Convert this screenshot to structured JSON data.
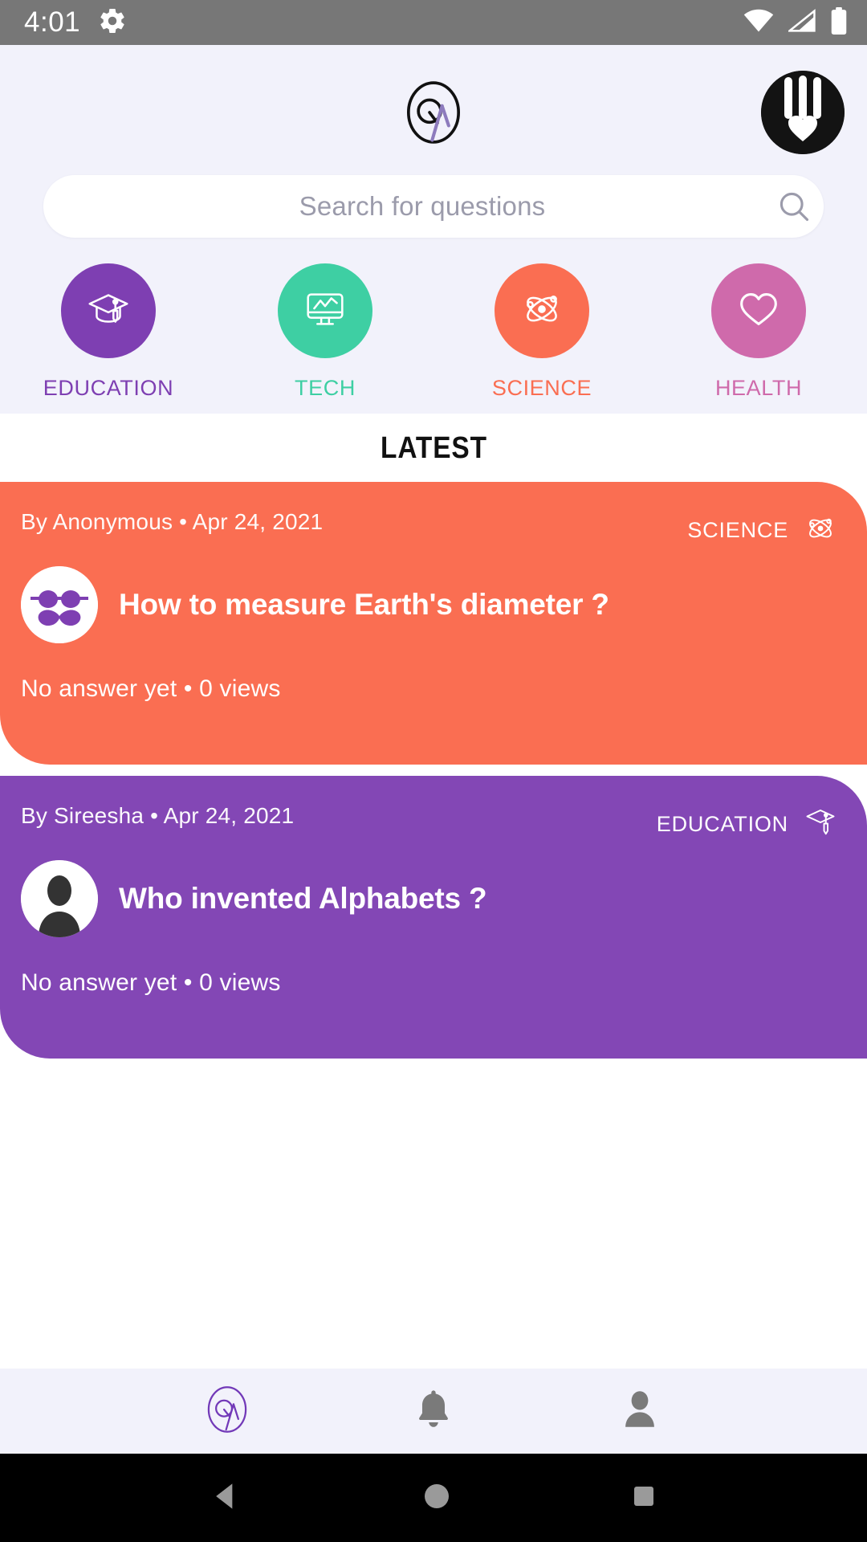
{
  "statusbar": {
    "time": "4:01",
    "icons": [
      "gear-icon",
      "wifi-icon",
      "cellular-signal-icon",
      "battery-icon"
    ]
  },
  "header": {
    "logo_name": "qa-logo",
    "logo_letters": "QA",
    "brand_avatar_name": "brand-avatar-icon"
  },
  "search": {
    "placeholder": "Search for questions",
    "value": "",
    "icon": "search-icon"
  },
  "categories": [
    {
      "label": "EDUCATION",
      "color": "#7E3FB2",
      "icon": "graduation-cap-icon"
    },
    {
      "label": "TECH",
      "color": "#3ECFA3",
      "icon": "monitor-chart-icon"
    },
    {
      "label": "SCIENCE",
      "color": "#FA6E52",
      "icon": "atom-icon"
    },
    {
      "label": "HEALTH",
      "color": "#CF6AAB",
      "icon": "heart-icon"
    }
  ],
  "section": {
    "latest_title": "LATEST"
  },
  "feed": [
    {
      "byline": "By Anonymous • Apr 24, 2021",
      "category": "SCIENCE",
      "category_icon": "atom-icon",
      "title": "How to measure Earth's diameter ?",
      "meta": "No answer yet • 0 views",
      "color": "#FA6E52",
      "avatar": "anonymous-mustache-avatar"
    },
    {
      "byline": "By Sireesha • Apr 24, 2021",
      "category": "EDUCATION",
      "category_icon": "graduation-cap-icon",
      "title": "Who invented Alphabets ?",
      "meta": "No answer yet • 0 views",
      "color": "#8347B5",
      "avatar": "default-person-avatar"
    }
  ],
  "bottomnav": [
    {
      "name": "home-qa-icon",
      "active": true
    },
    {
      "name": "notifications-bell-icon",
      "active": false
    },
    {
      "name": "profile-person-icon",
      "active": false
    }
  ],
  "androidnav": [
    {
      "name": "back-button"
    },
    {
      "name": "home-button"
    },
    {
      "name": "recents-button"
    }
  ],
  "colors": {
    "page_tint": "#F2F2FB",
    "statusbar": "#777777",
    "accent_purple": "#7E3FB2",
    "accent_orange": "#FA6E52"
  }
}
